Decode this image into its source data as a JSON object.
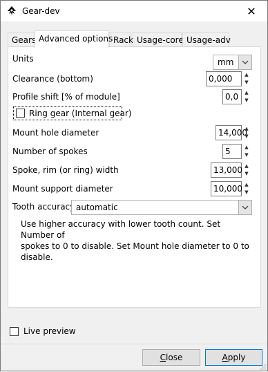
{
  "window": {
    "title": "Gear-dev",
    "close_glyph": "✕"
  },
  "tabs": [
    {
      "label": "Gears"
    },
    {
      "label": "Advanced options"
    },
    {
      "label": "Rack"
    },
    {
      "label": "Usage-core"
    },
    {
      "label": "Usage-adv"
    }
  ],
  "fields": {
    "units": {
      "label": "Units",
      "value": "mm"
    },
    "clearance": {
      "label": "Clearance (bottom)",
      "value": "0,000"
    },
    "profile_shift": {
      "label": "Profile shift [% of module]",
      "value": "0,0"
    },
    "ring_gear": {
      "label": "Ring gear (Internal gear)",
      "checked": false
    },
    "mount_hole": {
      "label": "Mount hole diameter",
      "value": "14,000"
    },
    "spokes": {
      "label": "Number of spokes",
      "value": "5"
    },
    "spoke_width": {
      "label": "Spoke, rim (or ring) width",
      "value": "13,000"
    },
    "mount_support": {
      "label": "Mount support diameter",
      "value": "10,000"
    },
    "tooth_accuracy": {
      "label": "Tooth accuracy",
      "value": "automatic"
    }
  },
  "description": [
    "Use higher accuracy with lower tooth count. Set Number of",
    "spokes to 0 to disable. Set Mount hole diameter to 0 to disable."
  ],
  "live_preview": {
    "label": "Live preview",
    "checked": false
  },
  "buttons": {
    "close": {
      "mnemonic": "C",
      "rest": "lose"
    },
    "apply": {
      "mnemonic": "A",
      "rest": "pply"
    }
  },
  "icons": {
    "app": "inkscape-icon",
    "close": "close-icon"
  },
  "colors": {
    "accent": "#0078d7",
    "panel": "#ffffff",
    "background": "#f0f0f0"
  }
}
